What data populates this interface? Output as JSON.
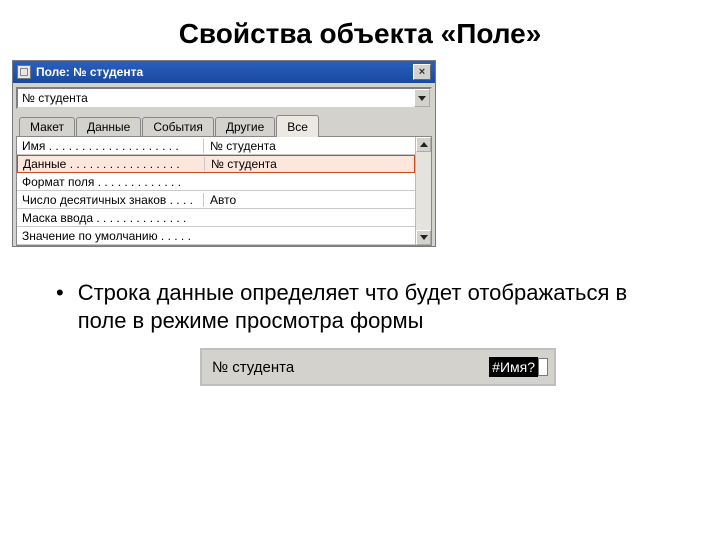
{
  "slide_title": "Свойства объекта «Поле»",
  "window": {
    "title": "Поле: № студента",
    "close_glyph": "×",
    "dropdown_value": "№ студента",
    "tabs": [
      {
        "label": "Макет"
      },
      {
        "label": "Данные"
      },
      {
        "label": "События"
      },
      {
        "label": "Другие"
      },
      {
        "label": "Все",
        "active": true
      }
    ],
    "rows": [
      {
        "label": "Имя . . . . . . . . . . . . . . . . . . . .",
        "value": "№ студента"
      },
      {
        "label": "Данные . . . . . . . . . . . . . . . . .",
        "value": "№ студента",
        "highlight": true
      },
      {
        "label": "Формат поля . . . . . . . . . . . . .",
        "value": ""
      },
      {
        "label": "Число десятичных знаков . . . .",
        "value": "Авто"
      },
      {
        "label": "Маска ввода . . . . . . . . . . . . . .",
        "value": ""
      },
      {
        "label": "Значение по умолчанию . . . . .",
        "value": ""
      }
    ]
  },
  "bullet": "Строка данные определяет что будет отображаться в поле в режиме просмотра формы",
  "preview": {
    "label": "№ студента",
    "value": "#Имя?"
  }
}
